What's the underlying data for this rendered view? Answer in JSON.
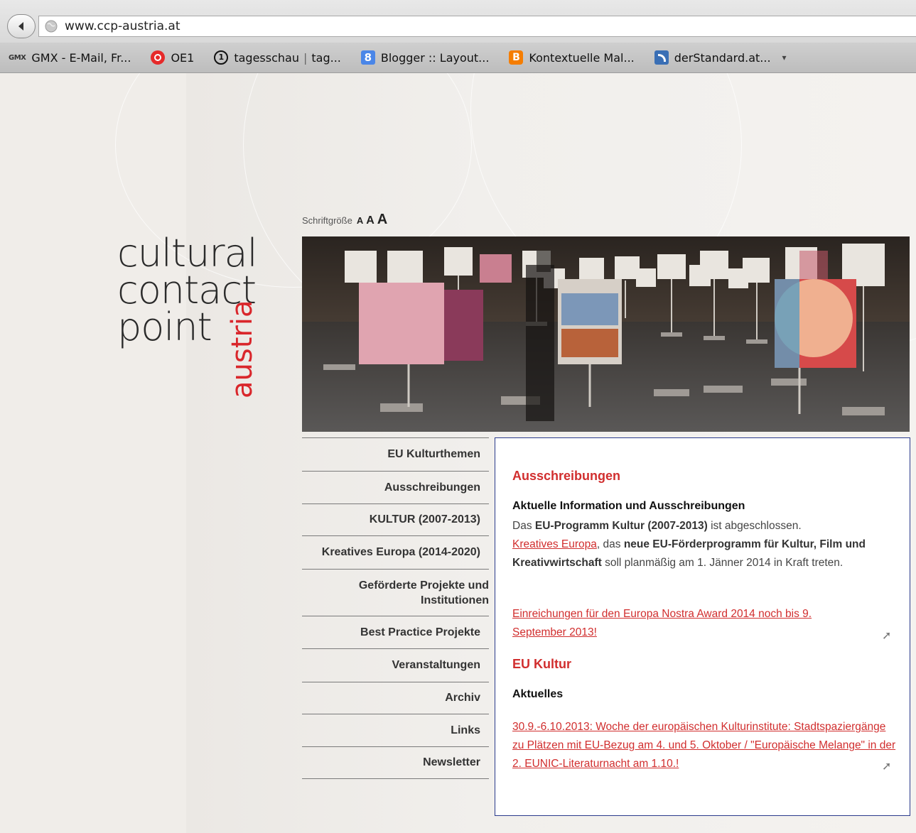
{
  "browser": {
    "url": "www.ccp-austria.at",
    "bookmarks": [
      {
        "label": "GMX - E-Mail, Fr...",
        "icon": "gmx-icon"
      },
      {
        "label": "OE1",
        "icon": "oe1-icon"
      },
      {
        "label": "tagesschau",
        "label2": "tag...",
        "icon": "ard-icon"
      },
      {
        "label": "Blogger :: Layout...",
        "icon": "google-icon"
      },
      {
        "label": "Kontextuelle Mal...",
        "icon": "blogger-icon"
      },
      {
        "label": "derStandard.at...",
        "icon": "rss-icon"
      }
    ],
    "gmx_icon_text": "GMX",
    "blogger_icon_text": "B",
    "google_icon_text": "8",
    "ard_icon_text": "1"
  },
  "logo": {
    "line1": "cultural",
    "line2": "contact",
    "line3": "point",
    "austria": "austria"
  },
  "fontsize": {
    "label": "Schriftgröße",
    "small": "A",
    "medium": "A",
    "large": "A"
  },
  "nav": {
    "items": [
      "EU Kulturthemen",
      "Ausschreibungen",
      "KULTUR (2007-2013)",
      "Kreatives Europa (2014-2020)",
      "Geförderte Projekte und Institutionen",
      "Best Practice Projekte",
      "Veranstaltungen",
      "Archiv",
      "Links",
      "Newsletter"
    ]
  },
  "content": {
    "section1": {
      "heading": "Ausschreibungen",
      "subheading": "Aktuelle Information und Ausschreibungen",
      "p1_a": "Das ",
      "p1_b": "EU-Programm Kultur (2007-2013)",
      "p1_c": " ist abgeschlossen.",
      "p2_link": "Kreatives Europa",
      "p2_a": ", das ",
      "p2_b": "neue EU-Förderprogramm für Kultur, Film und Kreativwirtschaft",
      "p2_c": " soll planmäßig am 1. Jänner 2014 in Kraft treten.",
      "link2": "Einreichungen für den Europa Nostra Award 2014 noch bis 9. September 2013!"
    },
    "section2": {
      "heading": "EU Kultur",
      "subheading": "Aktuelles",
      "link": "30.9.-6.10.2013: Woche der europäischen Kulturinstitute: Stadtspaziergänge zu Plätzen mit EU-Bezug am 4. und 5. Oktober / \"Europäische Melange\" in der 2. EUNIC-Literaturnacht am 1.10.!"
    }
  },
  "colors": {
    "accent_red": "#d12e2e",
    "logo_red": "#d9262b",
    "content_border": "#2a3a8c"
  }
}
